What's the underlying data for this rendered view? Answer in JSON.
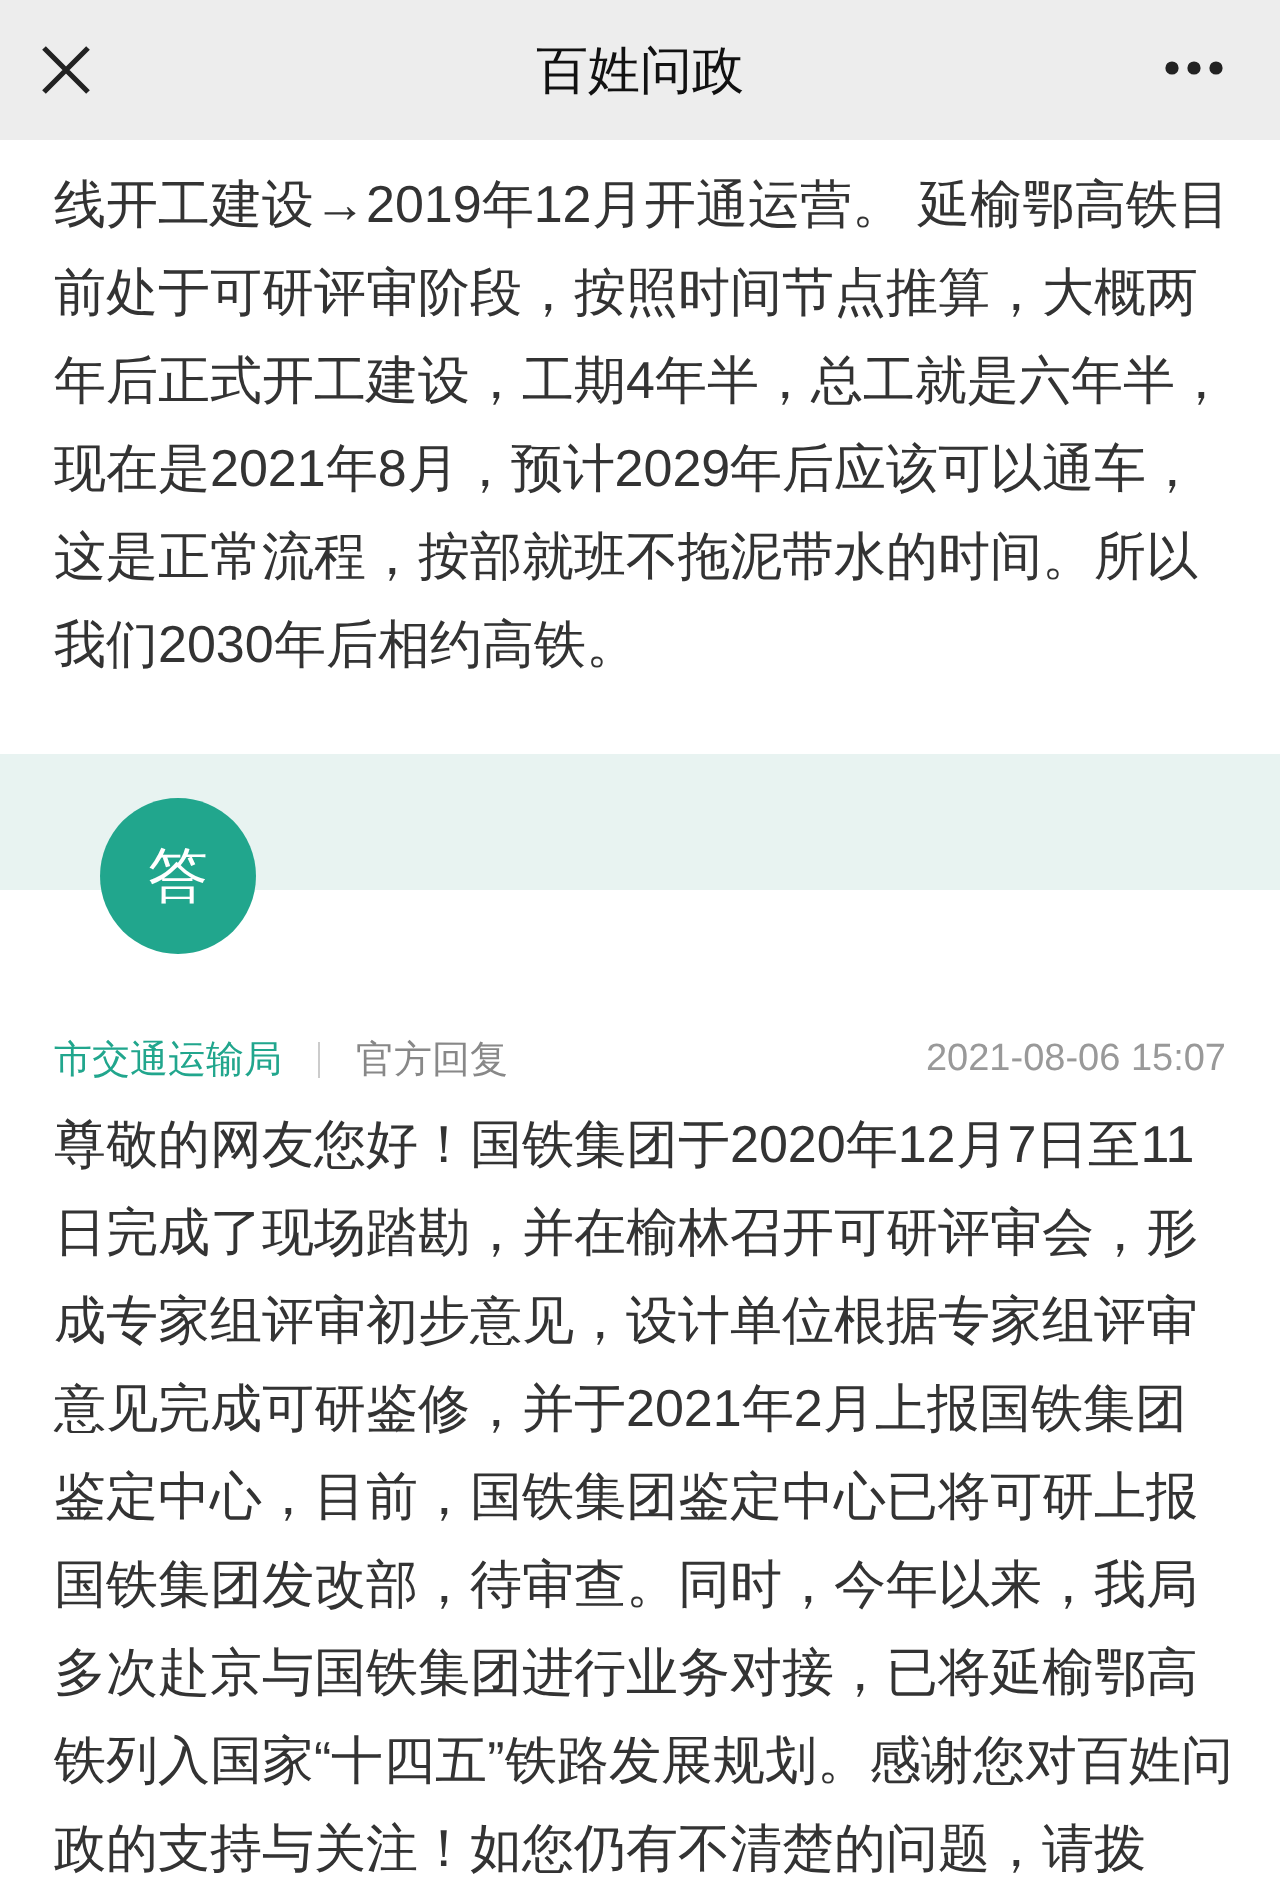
{
  "header": {
    "title": "百姓问政"
  },
  "question_text": "线开工建设→2019年12月开通运营。 延榆鄂高铁目前处于可研评审阶段，按照时间节点推算，大概两年后正式开工建设，工期4年半，总工就是六年半，现在是2021年8月，预计2029年后应该可以通车，这是正常流程，按部就班不拖泥带水的时间。所以我们2030年后相约高铁。",
  "answer": {
    "badge": "答",
    "department": "市交通运输局",
    "tag": "官方回复",
    "time": "2021-08-06 15:07",
    "text": "尊敬的网友您好！国铁集团于2020年12月7日至11日完成了现场踏勘，并在榆林召开可研评审会，形成专家组评审初步意见，设计单位根据专家组评审意见完成可研鉴修，并于2021年2月上报国铁集团鉴定中心，目前，国铁集团鉴定中心已将可研上报国铁集团发改部，待审查。同时，今年以来，我局多次赴京与国铁集团进行业务对接，已将延榆鄂高铁列入国家“十四五”铁路发展规划。感谢您对百姓问政的支持与关注！如您仍有不清楚的问题，请拨"
  }
}
